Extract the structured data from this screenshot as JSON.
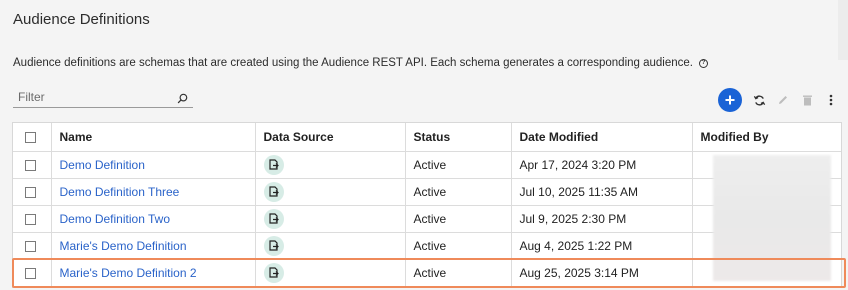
{
  "page": {
    "title": "Audience Definitions",
    "description": "Audience definitions are schemas that are created using the Audience REST API. Each schema generates a corresponding audience."
  },
  "filter": {
    "placeholder": "Filter"
  },
  "toolbar": {
    "icons": [
      "add-icon",
      "refresh-icon",
      "edit-icon",
      "delete-icon",
      "more-vertical-icon"
    ]
  },
  "table": {
    "columns": {
      "name": "Name",
      "data_source": "Data Source",
      "status": "Status",
      "date_modified": "Date Modified",
      "modified_by": "Modified By"
    },
    "rows": [
      {
        "name": "Demo Definition",
        "status": "Active",
        "date_modified": "Apr 17, 2024 3:20 PM"
      },
      {
        "name": "Demo Definition Three",
        "status": "Active",
        "date_modified": "Jul 10, 2025 11:35 AM"
      },
      {
        "name": "Demo Definition Two",
        "status": "Active",
        "date_modified": "Jul 9, 2025 2:30 PM"
      },
      {
        "name": "Marie's Demo Definition",
        "status": "Active",
        "date_modified": "Aug 4, 2025 1:22 PM"
      },
      {
        "name": "Marie's Demo Definition 2",
        "status": "Active",
        "date_modified": "Aug 25, 2025 3:14 PM"
      }
    ]
  },
  "colors": {
    "accent": "#1a63d6",
    "link": "#2a63c9",
    "highlight": "#ef8a5a"
  }
}
